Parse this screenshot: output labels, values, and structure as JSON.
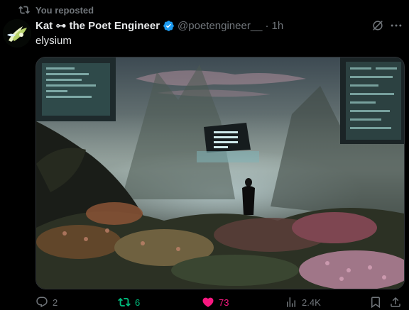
{
  "repost": {
    "label": "You reposted"
  },
  "author": {
    "name": "Kat ⊶ the Poet Engineer",
    "handle": "@poetengineer__",
    "separator": "·",
    "time": "1h",
    "verified": true
  },
  "tweet": {
    "text": "elysium"
  },
  "actions": {
    "replies": "2",
    "reposts": "6",
    "likes": "73",
    "views": "2.4K"
  },
  "icons": {
    "repost": "repost-icon",
    "verified": "verified-badge-icon",
    "grok": "grok-icon",
    "more": "more-icon",
    "reply": "reply-icon",
    "retweet": "retweet-icon",
    "like": "heart-icon",
    "views": "views-icon",
    "bookmark": "bookmark-icon",
    "share": "share-icon"
  },
  "colors": {
    "accent_blue": "#1d9bf0",
    "retweet_green": "#00ba7c",
    "like_pink": "#f91880",
    "muted": "#71767b",
    "text": "#e7e9ea",
    "background": "#000000"
  }
}
